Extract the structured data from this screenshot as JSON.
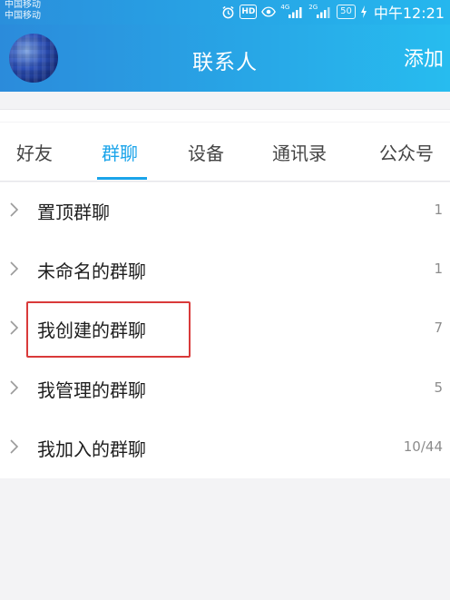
{
  "status_bar": {
    "carrier_1": "中国移动",
    "carrier_2": "中国移动",
    "hd": "HD",
    "net_1": "4G",
    "net_2": "2G",
    "battery": "50",
    "time": "中午12:21"
  },
  "header": {
    "title": "联系人",
    "add_label": "添加"
  },
  "tabs": [
    {
      "label": "好友",
      "active": false
    },
    {
      "label": "群聊",
      "active": true
    },
    {
      "label": "设备",
      "active": false
    },
    {
      "label": "通讯录",
      "active": false
    },
    {
      "label": "公众号",
      "active": false
    }
  ],
  "groups": [
    {
      "label": "置顶群聊",
      "count": "1"
    },
    {
      "label": "未命名的群聊",
      "count": "1"
    },
    {
      "label": "我创建的群聊",
      "count": "7"
    },
    {
      "label": "我管理的群聊",
      "count": "5"
    },
    {
      "label": "我加入的群聊",
      "count": "10/44"
    }
  ],
  "highlight_color": "#d93a3a",
  "accent_color": "#1aa4ea"
}
